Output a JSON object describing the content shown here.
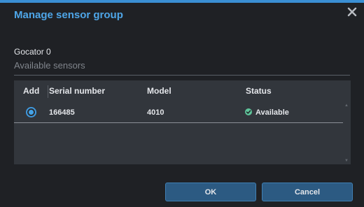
{
  "dialog": {
    "title": "Manage sensor group",
    "close_icon": "close-icon"
  },
  "group": {
    "name": "Gocator 0",
    "section_label": "Available sensors"
  },
  "table": {
    "columns": [
      "Add",
      "Serial number",
      "Model",
      "Status"
    ],
    "rows": [
      {
        "selected": true,
        "serial": "166485",
        "model": "4010",
        "status": "Available",
        "status_icon": "check-circle-icon",
        "status_color": "#5ec49a"
      }
    ]
  },
  "buttons": {
    "ok_label": "OK",
    "cancel_label": "Cancel"
  },
  "colors": {
    "accent": "#3a8fd4",
    "title": "#4ea6e8",
    "button_bg": "#2c5a82"
  }
}
